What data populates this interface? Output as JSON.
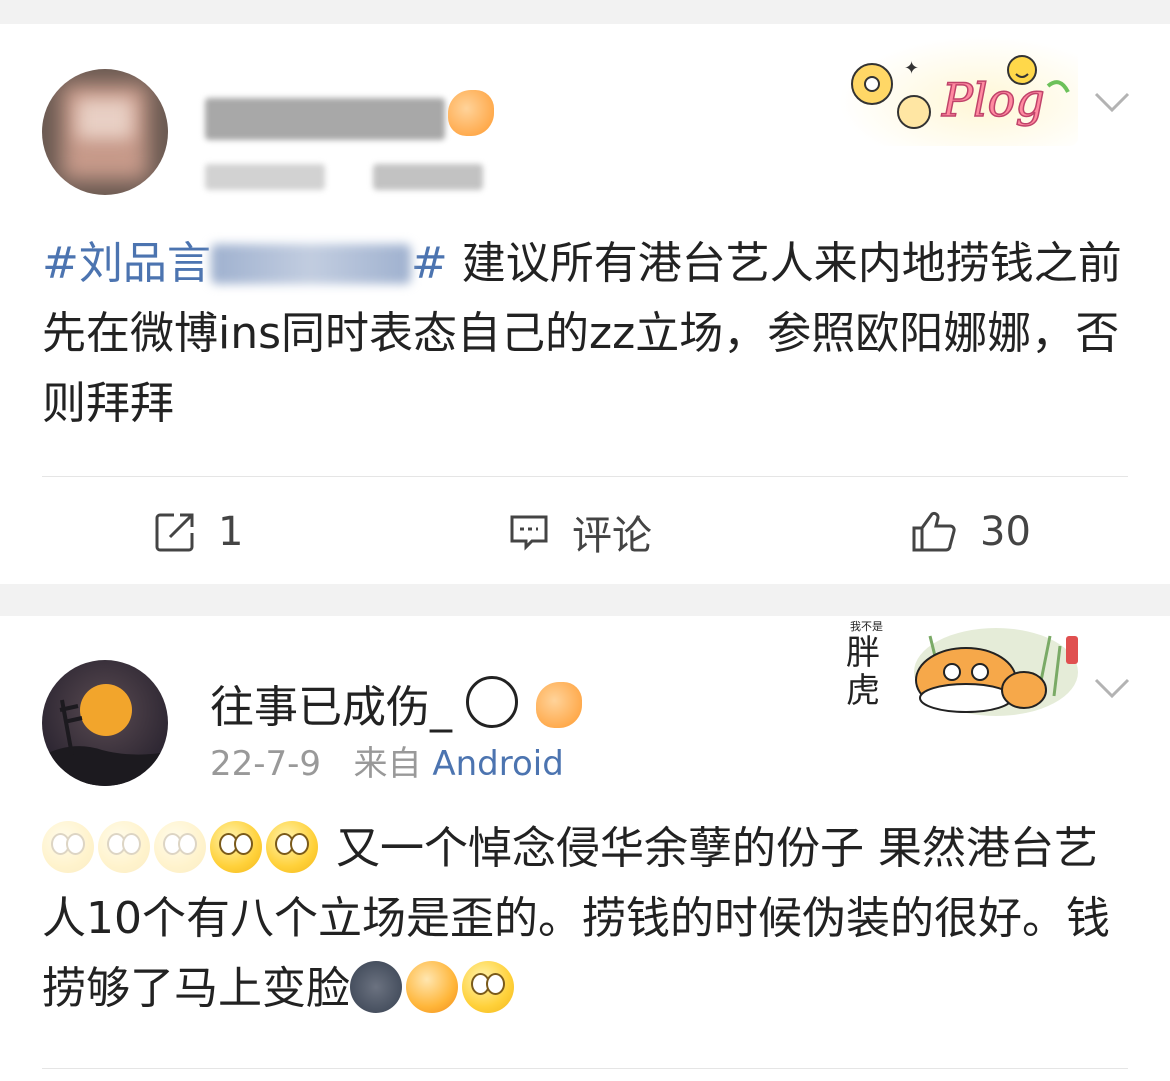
{
  "posts": [
    {
      "username": "",
      "timestamp": "",
      "source": "",
      "hashtag_start": "#刘品言#",
      "hashtag_end": "#",
      "text": " 建议所有港台艺人来内地捞钱之前先在微博ins同时表态自己的zz立场，参照欧阳娜娜，否则拜拜",
      "sticker": "plog-sticker",
      "actions": {
        "repost_count": "1",
        "comment_label": "评论",
        "like_count": "30"
      }
    },
    {
      "username": "往事已成伤_",
      "timestamp": "22-7-9",
      "source_prefix": "来自",
      "source": "Android",
      "text_line": "又一个悼念侵华余孽的份子 果然港台艺人10个有八个立场是歪的。捞钱的时候伪装的很好。钱捞够了马上变脸",
      "sticker": "胖虎",
      "sticker_small": "我不是"
    }
  ],
  "icons": {
    "repost": "repost-icon",
    "comment": "comment-icon",
    "like": "thumbs-up-icon",
    "chevron": "chevron-down-icon"
  },
  "colors": {
    "link": "#4c74b0",
    "meta": "#999999",
    "background": "#f2f2f2"
  }
}
